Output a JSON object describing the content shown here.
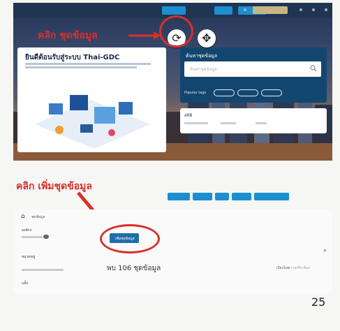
{
  "annotations": {
    "click_dataset": "คลิก ชุดข้อมูล",
    "click_add_dataset": "คลิก เพิ่มชุดข้อมูล"
  },
  "top_screenshot": {
    "welcome_title": "ยินดีต้อนรับสู่ระบบ Thai-GDC",
    "search_title": "ค้นหาชุดข้อมูล",
    "search_placeholder": "ค้นหาชุดข้อมูล",
    "popular_label": "Popular tags",
    "stats_title": "สถิติ",
    "icons": {
      "refresh": "refresh-icon",
      "move": "move-icon",
      "search": "search-icon"
    }
  },
  "bottom_screenshot": {
    "breadcrumb": "ชุดข้อมูล",
    "facets": [
      "องค์กร",
      "หมวดหมู่",
      "แท็ก"
    ],
    "add_button_label": "เพิ่มชุดข้อมูล",
    "found_text": "พบ 106 ชุดข้อมูล",
    "sort_label": "เรียงโดย",
    "sort_value": "ความเกี่ยวข้อง"
  },
  "page_number": "25",
  "colors": {
    "accent_red": "#d7312b",
    "nav_blue": "#1b8fd0",
    "panel_navy": "#13466e"
  }
}
